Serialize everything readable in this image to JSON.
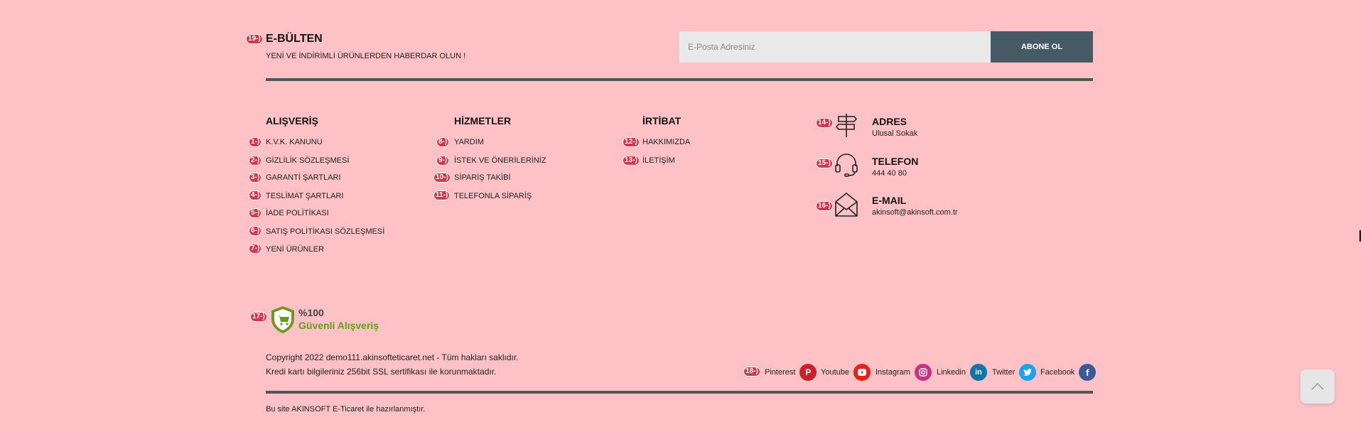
{
  "newsletter": {
    "tag": "19-)",
    "title": "E-BÜLTEN",
    "subtitle": "YENİ VE İNDİRİMLİ ÜRÜNLERDEN HABERDAR OLUN !",
    "email_placeholder": "E-Posta Adresiniz",
    "email_value": "",
    "subscribe_label": "ABONE OL"
  },
  "columns": [
    {
      "title": "ALIŞVERİŞ",
      "links": [
        {
          "tag": "1-)",
          "label": "K.V.K. KANUNU"
        },
        {
          "tag": "2-)",
          "label": "GİZLİLİK SÖZLEŞMESİ"
        },
        {
          "tag": "3-)",
          "label": "GARANTİ ŞARTLARI"
        },
        {
          "tag": "4-)",
          "label": "TESLİMAT ŞARTLARI"
        },
        {
          "tag": "5-)",
          "label": "İADE POLİTİKASI"
        },
        {
          "tag": "6-)",
          "label": "SATIŞ POLİTİKASI SÖZLEŞMESİ"
        },
        {
          "tag": "7-)",
          "label": "YENİ ÜRÜNLER"
        }
      ]
    },
    {
      "title": "HİZMETLER",
      "links": [
        {
          "tag": "8-)",
          "label": "YARDIM"
        },
        {
          "tag": "9-)",
          "label": "İSTEK VE ÖNERİLERİNİZ"
        },
        {
          "tag": "10-)",
          "label": "SİPARİŞ TAKİBİ"
        },
        {
          "tag": "11-)",
          "label": "TELEFONLA SİPARİŞ"
        }
      ]
    },
    {
      "title": "İRTİBAT",
      "links": [
        {
          "tag": "12-)",
          "label": "HAKKIMIZDA"
        },
        {
          "tag": "13-)",
          "label": "İLETİŞİM"
        }
      ]
    }
  ],
  "contact": [
    {
      "tag": "14-)",
      "icon": "signpost-icon",
      "title": "ADRES",
      "value": "Ulusal Sokak"
    },
    {
      "tag": "15-)",
      "icon": "headset-icon",
      "title": "TELEFON",
      "value": "444 40 80"
    },
    {
      "tag": "16-)",
      "icon": "envelope-icon",
      "title": "E-MAIL",
      "value": "akinsoft@akinsoft.com.tr"
    }
  ],
  "secure": {
    "tag": "17-)",
    "icon": "shield-cart-icon",
    "percent": "%100",
    "label": "Güvenli Alışveriş",
    "green": "#6a9a1c"
  },
  "copyright": {
    "line1": "Copyright 2022 demo111.akinsofteticaret.net - Tüm hakları saklıdır.",
    "line2": "Kredi kartı bilgileriniz 256bit SSL sertifikası ile korunmaktadır."
  },
  "social": {
    "tag": "18-)",
    "items": [
      {
        "label": "Pinterest",
        "icon": "pinterest-icon",
        "color": "#cb2027"
      },
      {
        "label": "Youtube",
        "icon": "youtube-icon",
        "color": "#e62117"
      },
      {
        "label": "Instagram",
        "icon": "instagram-icon",
        "color": "#c13584"
      },
      {
        "label": "Linkedin",
        "icon": "linkedin-icon",
        "color": "#0e76a8"
      },
      {
        "label": "Twitter",
        "icon": "twitter-icon",
        "color": "#1da1f2"
      },
      {
        "label": "Facebook",
        "icon": "facebook-icon",
        "color": "#3b5998"
      }
    ]
  },
  "made_by": "Bu site AKINSOFT E-Ticaret ile hazırlanmıştır.",
  "colors": {
    "background": "#fdc1c6",
    "button": "#455a64",
    "divider": "#555555",
    "tag": "#d9354a"
  }
}
